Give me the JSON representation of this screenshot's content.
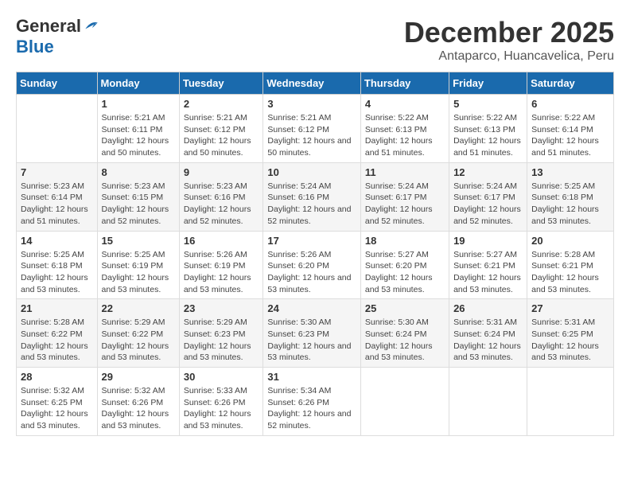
{
  "header": {
    "logo_general": "General",
    "logo_blue": "Blue",
    "month": "December 2025",
    "location": "Antaparco, Huancavelica, Peru"
  },
  "calendar": {
    "days_of_week": [
      "Sunday",
      "Monday",
      "Tuesday",
      "Wednesday",
      "Thursday",
      "Friday",
      "Saturday"
    ],
    "weeks": [
      [
        {
          "day": "",
          "info": ""
        },
        {
          "day": "1",
          "info": "Sunrise: 5:21 AM\nSunset: 6:11 PM\nDaylight: 12 hours\nand 50 minutes."
        },
        {
          "day": "2",
          "info": "Sunrise: 5:21 AM\nSunset: 6:12 PM\nDaylight: 12 hours\nand 50 minutes."
        },
        {
          "day": "3",
          "info": "Sunrise: 5:21 AM\nSunset: 6:12 PM\nDaylight: 12 hours\nand 50 minutes."
        },
        {
          "day": "4",
          "info": "Sunrise: 5:22 AM\nSunset: 6:13 PM\nDaylight: 12 hours\nand 51 minutes."
        },
        {
          "day": "5",
          "info": "Sunrise: 5:22 AM\nSunset: 6:13 PM\nDaylight: 12 hours\nand 51 minutes."
        },
        {
          "day": "6",
          "info": "Sunrise: 5:22 AM\nSunset: 6:14 PM\nDaylight: 12 hours\nand 51 minutes."
        }
      ],
      [
        {
          "day": "7",
          "info": "Sunrise: 5:23 AM\nSunset: 6:14 PM\nDaylight: 12 hours\nand 51 minutes."
        },
        {
          "day": "8",
          "info": "Sunrise: 5:23 AM\nSunset: 6:15 PM\nDaylight: 12 hours\nand 52 minutes."
        },
        {
          "day": "9",
          "info": "Sunrise: 5:23 AM\nSunset: 6:16 PM\nDaylight: 12 hours\nand 52 minutes."
        },
        {
          "day": "10",
          "info": "Sunrise: 5:24 AM\nSunset: 6:16 PM\nDaylight: 12 hours\nand 52 minutes."
        },
        {
          "day": "11",
          "info": "Sunrise: 5:24 AM\nSunset: 6:17 PM\nDaylight: 12 hours\nand 52 minutes."
        },
        {
          "day": "12",
          "info": "Sunrise: 5:24 AM\nSunset: 6:17 PM\nDaylight: 12 hours\nand 52 minutes."
        },
        {
          "day": "13",
          "info": "Sunrise: 5:25 AM\nSunset: 6:18 PM\nDaylight: 12 hours\nand 53 minutes."
        }
      ],
      [
        {
          "day": "14",
          "info": "Sunrise: 5:25 AM\nSunset: 6:18 PM\nDaylight: 12 hours\nand 53 minutes."
        },
        {
          "day": "15",
          "info": "Sunrise: 5:25 AM\nSunset: 6:19 PM\nDaylight: 12 hours\nand 53 minutes."
        },
        {
          "day": "16",
          "info": "Sunrise: 5:26 AM\nSunset: 6:19 PM\nDaylight: 12 hours\nand 53 minutes."
        },
        {
          "day": "17",
          "info": "Sunrise: 5:26 AM\nSunset: 6:20 PM\nDaylight: 12 hours\nand 53 minutes."
        },
        {
          "day": "18",
          "info": "Sunrise: 5:27 AM\nSunset: 6:20 PM\nDaylight: 12 hours\nand 53 minutes."
        },
        {
          "day": "19",
          "info": "Sunrise: 5:27 AM\nSunset: 6:21 PM\nDaylight: 12 hours\nand 53 minutes."
        },
        {
          "day": "20",
          "info": "Sunrise: 5:28 AM\nSunset: 6:21 PM\nDaylight: 12 hours\nand 53 minutes."
        }
      ],
      [
        {
          "day": "21",
          "info": "Sunrise: 5:28 AM\nSunset: 6:22 PM\nDaylight: 12 hours\nand 53 minutes."
        },
        {
          "day": "22",
          "info": "Sunrise: 5:29 AM\nSunset: 6:22 PM\nDaylight: 12 hours\nand 53 minutes."
        },
        {
          "day": "23",
          "info": "Sunrise: 5:29 AM\nSunset: 6:23 PM\nDaylight: 12 hours\nand 53 minutes."
        },
        {
          "day": "24",
          "info": "Sunrise: 5:30 AM\nSunset: 6:23 PM\nDaylight: 12 hours\nand 53 minutes."
        },
        {
          "day": "25",
          "info": "Sunrise: 5:30 AM\nSunset: 6:24 PM\nDaylight: 12 hours\nand 53 minutes."
        },
        {
          "day": "26",
          "info": "Sunrise: 5:31 AM\nSunset: 6:24 PM\nDaylight: 12 hours\nand 53 minutes."
        },
        {
          "day": "27",
          "info": "Sunrise: 5:31 AM\nSunset: 6:25 PM\nDaylight: 12 hours\nand 53 minutes."
        }
      ],
      [
        {
          "day": "28",
          "info": "Sunrise: 5:32 AM\nSunset: 6:25 PM\nDaylight: 12 hours\nand 53 minutes."
        },
        {
          "day": "29",
          "info": "Sunrise: 5:32 AM\nSunset: 6:26 PM\nDaylight: 12 hours\nand 53 minutes."
        },
        {
          "day": "30",
          "info": "Sunrise: 5:33 AM\nSunset: 6:26 PM\nDaylight: 12 hours\nand 53 minutes."
        },
        {
          "day": "31",
          "info": "Sunrise: 5:34 AM\nSunset: 6:26 PM\nDaylight: 12 hours\nand 52 minutes."
        },
        {
          "day": "",
          "info": ""
        },
        {
          "day": "",
          "info": ""
        },
        {
          "day": "",
          "info": ""
        }
      ]
    ]
  }
}
